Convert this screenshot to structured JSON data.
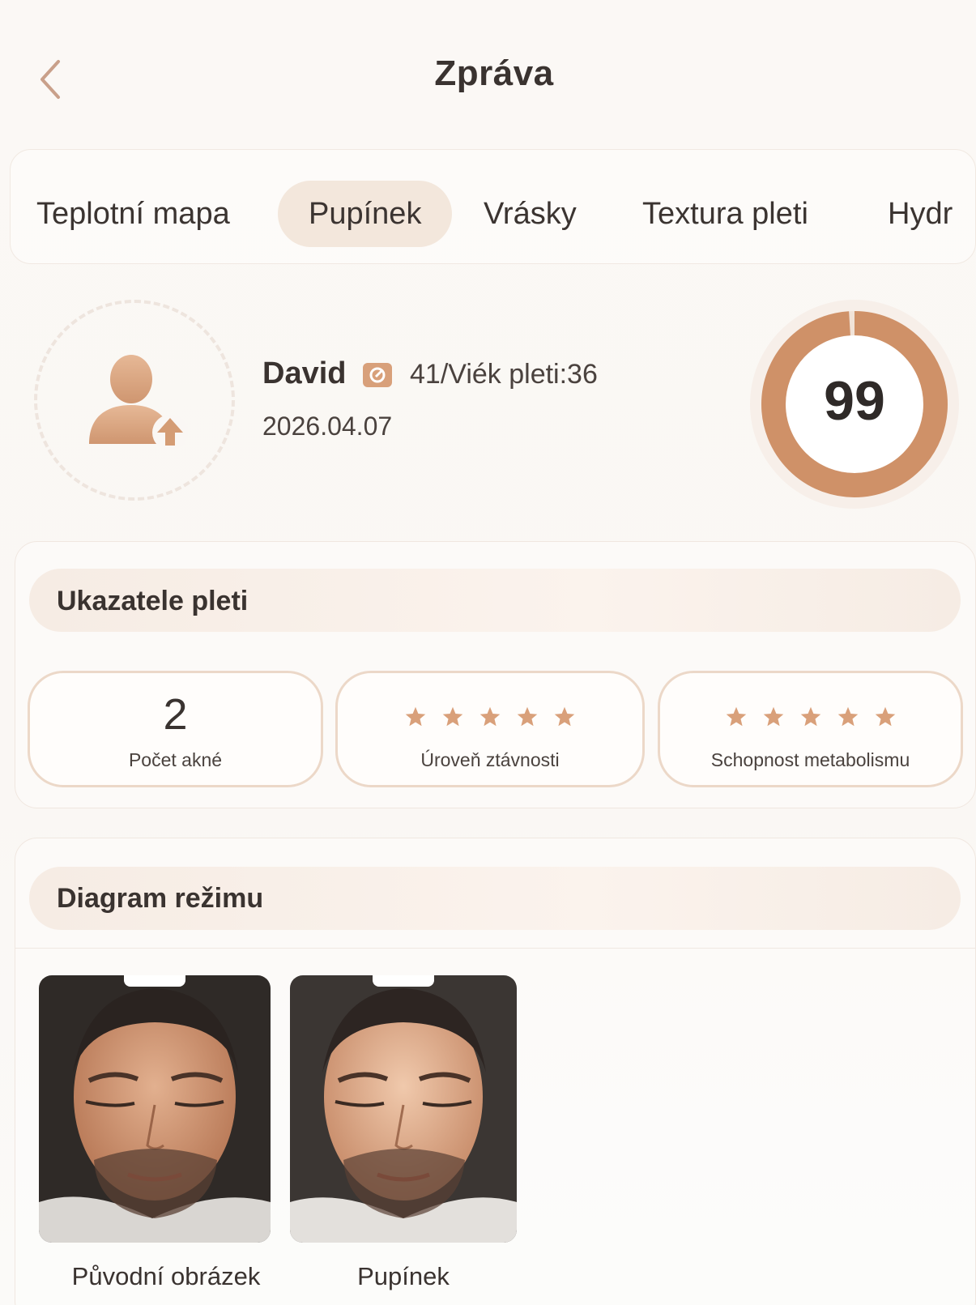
{
  "header": {
    "title": "Zpráva",
    "back_icon": "chevron-left-icon"
  },
  "tabs": [
    {
      "label": "Teplotní mapa",
      "active": false
    },
    {
      "label": "Pupínek",
      "active": true
    },
    {
      "label": "Vrásky",
      "active": false
    },
    {
      "label": "Textura pleti",
      "active": false
    },
    {
      "label": "Hydr",
      "active": false
    }
  ],
  "profile": {
    "name": "David",
    "age_text": "41/Viék pleti:36",
    "date": "2026.04.07",
    "score": "99",
    "score_fraction": 0.99
  },
  "indicators": {
    "title": "Ukazatele pleti",
    "acne_count": {
      "value": "2",
      "label": "Počet akné"
    },
    "fat_level": {
      "label": "Úroveň ztávnosti",
      "stars": 5,
      "max": 5
    },
    "metabolism": {
      "label": "Schopnost metabolismu",
      "stars": 5,
      "max": 5
    }
  },
  "diagram": {
    "title": "Diagram režimu",
    "photos": [
      {
        "caption": "Původní obrázek"
      },
      {
        "caption": "Pupínek"
      }
    ]
  },
  "colors": {
    "accent": "#d29a72",
    "accent_dark": "#c78a62",
    "tab_active_bg": "#f3e7dc",
    "text": "#3a3330"
  }
}
